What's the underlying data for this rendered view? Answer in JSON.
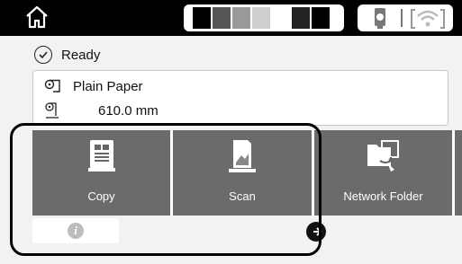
{
  "status": {
    "text": "Ready"
  },
  "paper": {
    "media_type": "Plain Paper",
    "width_value": "610.0",
    "width_unit": "mm"
  },
  "tiles": [
    {
      "label": "Copy",
      "icon": "copy-icon"
    },
    {
      "label": "Scan",
      "icon": "scan-icon"
    },
    {
      "label": "Network Folder",
      "icon": "network-folder-icon"
    }
  ],
  "icons": {
    "home": "home-icon",
    "ink": "ink-levels-icon",
    "wifi": "wifi-icon",
    "info": "info-icon"
  },
  "colors": {
    "topbar": "#000000",
    "tile": "#6b6b6b",
    "panel": "#f2f2f2",
    "highlight": "#000000"
  }
}
